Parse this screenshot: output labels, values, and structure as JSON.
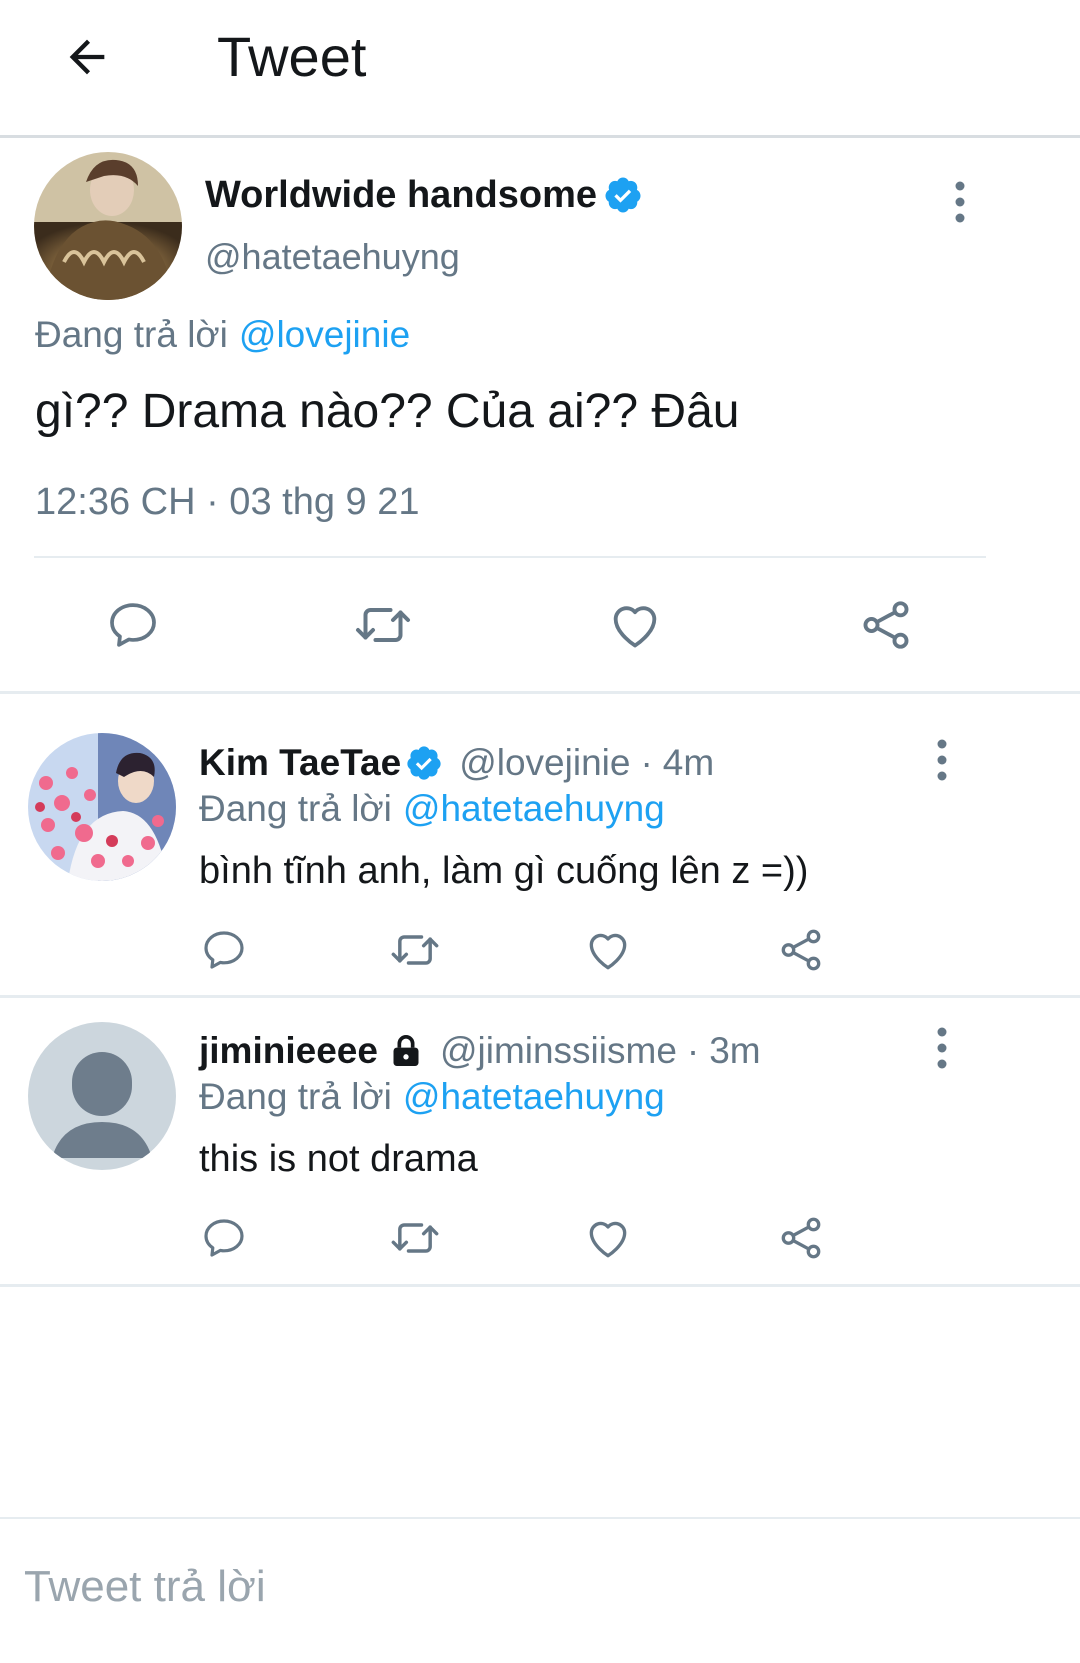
{
  "header": {
    "title": "Tweet"
  },
  "main_tweet": {
    "display_name": "Worldwide handsome",
    "handle": "@hatetaehuyng",
    "reply_prefix": "Đang trả lời",
    "reply_to": "@lovejinie",
    "text": "gì?? Drama nào?? Của ai?? Đâu",
    "timestamp": "12:36 CH · 03 thg 9 21"
  },
  "replies": [
    {
      "display_name": "Kim TaeTae",
      "handle": "@lovejinie",
      "sep": "·",
      "time": "4m",
      "reply_prefix": "Đang trả lời",
      "reply_to": "@hatetaehuyng",
      "text": "bình tĩnh anh, làm gì cuống lên z =))"
    },
    {
      "display_name": "jiminieeee",
      "handle": "@jiminssiisme",
      "sep": "·",
      "time": "3m",
      "reply_prefix": "Đang trả lời",
      "reply_to": "@hatetaehuyng",
      "text": "this is not drama"
    }
  ],
  "composer": {
    "placeholder": "Tweet trả lời"
  },
  "colors": {
    "accent": "#1da1f2",
    "muted": "#657786",
    "divider": "#e6ecf0"
  }
}
